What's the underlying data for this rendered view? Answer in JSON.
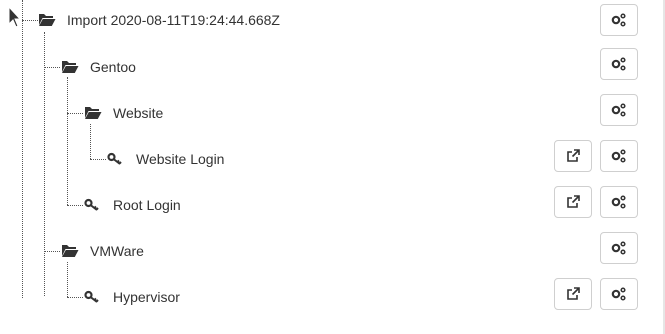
{
  "tree": {
    "nodes": [
      {
        "label": "Import 2020-08-11T19:24:44.668Z",
        "type": "folder",
        "depth": 0,
        "has_open_button": false
      },
      {
        "label": "Gentoo",
        "type": "folder",
        "depth": 1,
        "has_open_button": false
      },
      {
        "label": "Website",
        "type": "folder",
        "depth": 2,
        "has_open_button": false
      },
      {
        "label": "Website Login",
        "type": "login",
        "depth": 3,
        "has_open_button": true
      },
      {
        "label": "Root Login",
        "type": "login",
        "depth": 2,
        "has_open_button": true
      },
      {
        "label": "VMWare",
        "type": "folder",
        "depth": 1,
        "has_open_button": false
      },
      {
        "label": "Hypervisor",
        "type": "login",
        "depth": 2,
        "has_open_button": true
      }
    ]
  },
  "icons": {
    "folder": "folder-open-icon",
    "login": "key-icon",
    "settings": "cogs-icon",
    "open": "external-link-icon",
    "cursor": "mouse-pointer-icon"
  },
  "colors": {
    "text": "#333333",
    "icon": "#333333",
    "button_border": "#cfcfcf"
  }
}
